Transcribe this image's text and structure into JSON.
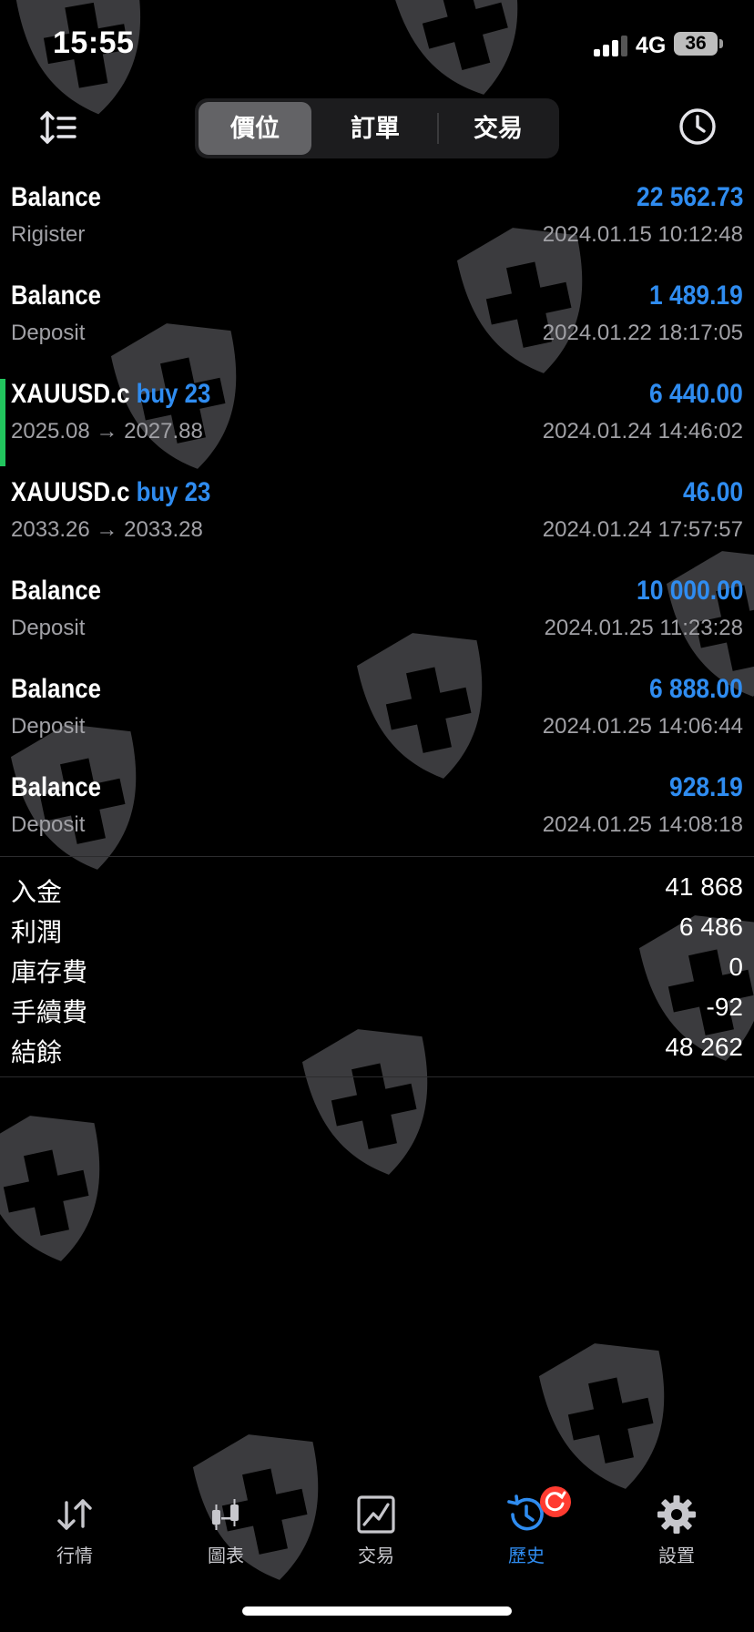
{
  "status_bar": {
    "time": "15:55",
    "network": "4G",
    "battery": "36"
  },
  "tabs_top": [
    {
      "label": "價位",
      "active": true
    },
    {
      "label": "訂單",
      "active": false
    },
    {
      "label": "交易",
      "active": false
    }
  ],
  "history": [
    {
      "title": "Balance",
      "side": "",
      "sub": "Rigister",
      "amount": "22 562.73",
      "date": "2024.01.15 10:12:48"
    },
    {
      "title": "Balance",
      "side": "",
      "sub": "Deposit",
      "amount": "1 489.19",
      "date": "2024.01.22 18:17:05"
    },
    {
      "title": "XAUUSD.c",
      "side": "buy 23",
      "sub": "2025.08 → 2027.88",
      "amount": "6 440.00",
      "date": "2024.01.24 14:46:02"
    },
    {
      "title": "XAUUSD.c",
      "side": "buy 23",
      "sub": "2033.26 → 2033.28",
      "amount": "46.00",
      "date": "2024.01.24 17:57:57"
    },
    {
      "title": "Balance",
      "side": "",
      "sub": "Deposit",
      "amount": "10 000.00",
      "date": "2024.01.25 11:23:28"
    },
    {
      "title": "Balance",
      "side": "",
      "sub": "Deposit",
      "amount": "6 888.00",
      "date": "2024.01.25 14:06:44"
    },
    {
      "title": "Balance",
      "side": "",
      "sub": "Deposit",
      "amount": "928.19",
      "date": "2024.01.25 14:08:18"
    }
  ],
  "summary": [
    {
      "label": "入金",
      "value": "41 868"
    },
    {
      "label": "利潤",
      "value": "6 486"
    },
    {
      "label": "庫存費",
      "value": "0"
    },
    {
      "label": "手續費",
      "value": "-92"
    },
    {
      "label": "結餘",
      "value": "48 262"
    }
  ],
  "tabbar": [
    {
      "label": "行情",
      "icon": "quotes-arrows-icon",
      "active": false
    },
    {
      "label": "圖表",
      "icon": "candlestick-chart-icon",
      "active": false
    },
    {
      "label": "交易",
      "icon": "trade-chart-icon",
      "active": false
    },
    {
      "label": "歷史",
      "icon": "history-icon",
      "active": true
    },
    {
      "label": "設置",
      "icon": "gear-icon",
      "active": false
    }
  ],
  "colors": {
    "accent": "#2f8cf0",
    "buy_marker": "#22c55e",
    "badge": "#ff3b30",
    "background": "#000000"
  }
}
